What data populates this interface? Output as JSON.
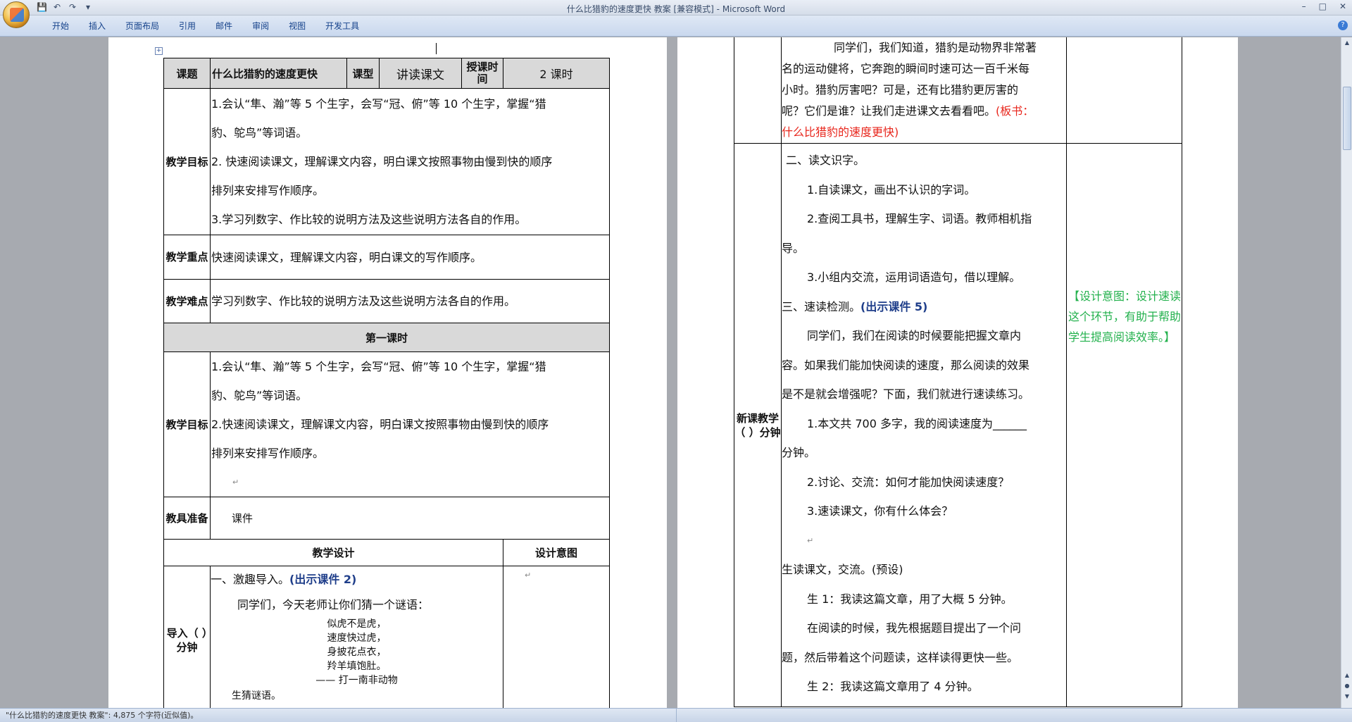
{
  "window": {
    "title": "什么比猎豹的速度更快 教案 [兼容模式] - Microsoft Word",
    "min": "–",
    "max": "□",
    "close": "✕"
  },
  "qat": {
    "save": "💾",
    "undo": "↶",
    "redo": "↷",
    "customize": "▾"
  },
  "ribbon": {
    "tabs": [
      "开始",
      "插入",
      "页面布局",
      "引用",
      "邮件",
      "审阅",
      "视图",
      "开发工具"
    ],
    "help": "?"
  },
  "page1": {
    "mark": "↵",
    "header": {
      "label_topic": "课题",
      "topic": "什么比猎豹的速度更快",
      "label_type": "课型",
      "type": "讲读课文",
      "label_time": "授课时间",
      "time": "2 课时"
    },
    "goals_label": "教学目标",
    "goals": [
      "1.会认“隼、瀚”等 5 个生字，会写“冠、俯”等 10 个生字，掌握“猎",
      "豹、鸵鸟”等词语。",
      "2.  快速阅读课文，理解课文内容，明白课文按照事物由慢到快的顺序",
      "排列来安排写作顺序。",
      "3.学习列数字、作比较的说明方法及这些说明方法各自的作用。"
    ],
    "key_label": "教学重点",
    "key": "快速阅读课文，理解课文内容，明白课文的写作顺序。",
    "diff_label": "教学难点",
    "diff": "学习列数字、作比较的说明方法及这些说明方法各自的作用。",
    "lesson1": "第一课时",
    "goals2_label": "教学目标",
    "goals2": [
      "1.会认“隼、瀚”等 5 个生字，会写“冠、俯”等 10 个生字，掌握“猎",
      "豹、鸵鸟”等词语。",
      "2.快速阅读课文，理解课文内容，明白课文按照事物由慢到快的顺序",
      "排列来安排写作顺序。"
    ],
    "tools_label": "教具准备",
    "tools": "课件",
    "design_label": "教学设计",
    "intent_label": "设计意图",
    "intro_label": "导入（   ）分钟",
    "intro_title": "一、激趣导入。",
    "intro_link": "(出示课件 2)",
    "intro_text": "同学们，今天老师让你们猜一个谜语：",
    "riddle": [
      "似虎不是虎，",
      "速度快过虎，",
      "身披花点衣，",
      "羚羊填饱肚。"
    ],
    "riddle_hint": "——  打一南非动物",
    "guess": "生猜谜语。"
  },
  "page2": {
    "intro_cont": [
      "同学们，我们知道，猎豹是动物界非常著",
      "名的运动健将，它奔跑的瞬间时速可达一百千米每",
      "小时。猎豹厉害吧？可是，还有比猎豹更厉害的",
      "呢？它们是谁？让我们走进课文去看看吧。"
    ],
    "board": "(板书：",
    "board2": "什么比猎豹的速度更快)",
    "new_label": "新课教学（   ）分钟",
    "sec2": "二、读文识字。",
    "items": [
      "1.自读课文，画出不认识的字词。",
      "2.查阅工具书，理解生字、词语。教师相机指",
      "导。",
      "3.小组内交流，运用词语造句，借以理解。"
    ],
    "sec3": "三、速读检测。",
    "sec3_link": "(出示课件 5)",
    "para": [
      "同学们，我们在阅读的时候要能把握文章内",
      "容。如果我们能加快阅读的速度，那么阅读的效果",
      "是不是就会增强呢？下面，我们就进行速读练习。"
    ],
    "q1": "1.本文共 700 多字，我的阅读速度为______",
    "q1b": "分钟。",
    "q2": "2.讨论、交流：如何才能加快阅读速度？",
    "q3": "3.速读课文，你有什么体会？",
    "pre": "生读课文，交流。(预设)",
    "s1": "生 1：我读这篇文章，用了大概 5 分钟。",
    "s1a": "在阅读的时候，我先根据题目提出了一个问",
    "s1b": "题，然后带着这个问题读，这样读得更快一些。",
    "s2": "生 2：我读这篇文章用了 4 分钟。",
    "intent": "【设计意图：设计速读这个环节，有助于帮助学生提高阅读效率。】"
  },
  "status": {
    "text": "\"什么比猎豹的速度更快 教案\": 4,875 个字符(近似值)。"
  }
}
